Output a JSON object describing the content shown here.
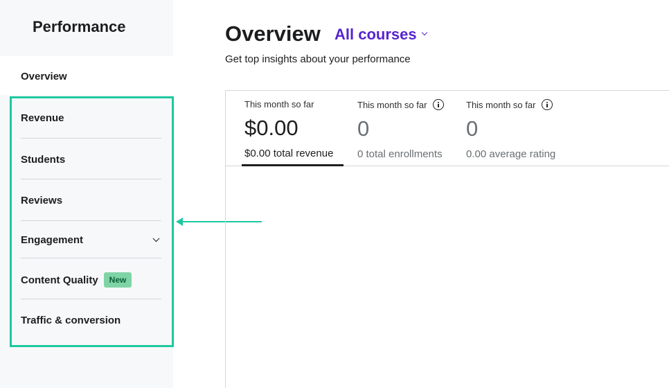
{
  "sidebar": {
    "title": "Performance",
    "overview": "Overview",
    "items": [
      {
        "label": "Revenue"
      },
      {
        "label": "Students"
      },
      {
        "label": "Reviews"
      },
      {
        "label": "Engagement"
      },
      {
        "label": "Content Quality",
        "badge": "New"
      },
      {
        "label": "Traffic & conversion"
      }
    ]
  },
  "header": {
    "title": "Overview",
    "course_filter": "All courses",
    "subtitle": "Get top insights about your performance"
  },
  "stats": [
    {
      "label": "This month so far",
      "value": "$0.00",
      "sub": "$0.00 total revenue",
      "active": true
    },
    {
      "label": "This month so far",
      "value": "0",
      "sub": "0 total enrollments",
      "active": false
    },
    {
      "label": "This month so far",
      "value": "0",
      "sub": "0.00 average rating",
      "active": false
    }
  ],
  "colors": {
    "accent": "#5624d0",
    "highlight": "#1ec8a0",
    "badge_bg": "#7fd4a5"
  }
}
